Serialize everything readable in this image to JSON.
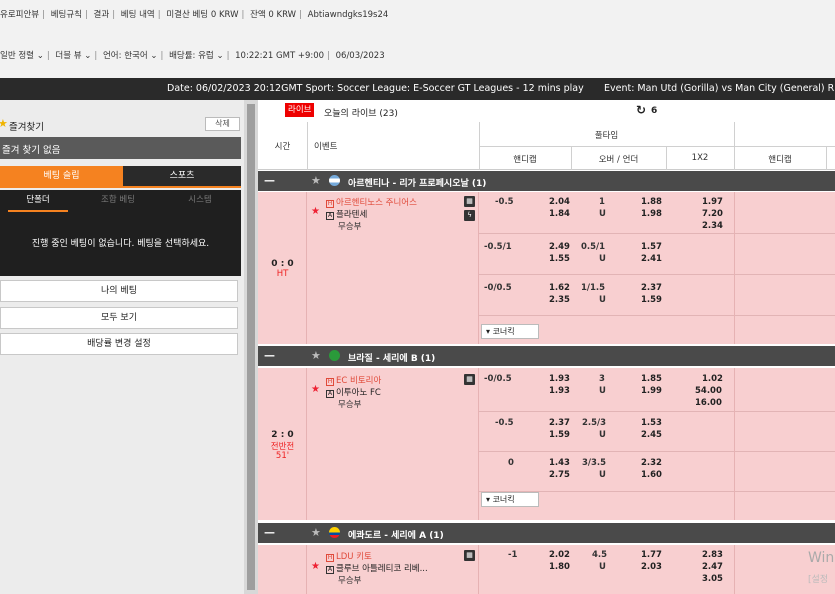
{
  "top_links": [
    "유로피안뷰",
    "베팅규칙",
    "결과",
    "베팅 내역",
    "미결산 베팅 0 KRW",
    "잔액 0 KRW",
    "Abtiawndgks19s24"
  ],
  "top_options": {
    "sort": "일반 정렬",
    "view": "더블 뷰",
    "language_label": "언어:",
    "language": "한국어",
    "odds_label": "배당률:",
    "odds": "유럽",
    "time": "10:22:21 GMT +9:00",
    "date": "06/03/2023"
  },
  "ticker": {
    "segment1": "Date: 06/02/2023 20:12GMT Sport: Soccer League: E-Soccer GT Leagues - 12 mins play",
    "segment2": "Event: Man Utd (Gorilla) vs Man City (General) R"
  },
  "sidebar": {
    "favorites_title": "즐겨찾기",
    "delete_label": "삭제",
    "no_favorites": "즐겨 찾기 없음",
    "tab_betslip": "베팅 슬립",
    "tab_sports": "스포츠",
    "subtab_single": "단폴더",
    "subtab_combo": "조합 베팅",
    "subtab_system": "시스템",
    "message": "진행 중인 베팅이 없습니다. 베팅을 선택하세요.",
    "btn_my_bets": "나의 베팅",
    "btn_view_all": "모두 보기",
    "btn_odds_settings": "배당률 변경 설정"
  },
  "live": {
    "badge": "라이브",
    "today": "오늘의 라이브 (23)",
    "refresh_icon": "refresh-icon",
    "refresh_count": "6"
  },
  "table_header": {
    "time": "시간",
    "event": "이벤트",
    "fulltime": "풀타임",
    "handicap": "핸디캡",
    "over_under": "오버 / 언더",
    "one_x_two": "1X2",
    "handicap2": "핸디캡"
  },
  "colors": {
    "accent": "#f58220",
    "live_red": "#e00000",
    "row_pink": "#f8cfd0",
    "league_bar": "#4a4a4a"
  },
  "leagues": [
    {
      "name": "아르헨티나 - 리가 프로페시오날 (1)",
      "flag": "argentina",
      "match": {
        "score": "0 : 0",
        "period": "HT",
        "minute": "",
        "home": "아르헨티노스 주니어스",
        "away": "플라텐세",
        "draw": "무승부",
        "rows": [
          {
            "hdp": "-0.5",
            "hdp_h": "2.04",
            "hdp_a": "1.84",
            "ou": "1",
            "ou_u": "",
            "ou_o": "1.88",
            "ou_un": "1.98",
            "x1": "1.97",
            "x2": "7.20",
            "xx": "2.34"
          },
          {
            "hdp": "-0.5/1",
            "hdp_h": "2.49",
            "hdp_a": "1.55",
            "ou": "0.5/1",
            "ou_u": "U",
            "ou_o": "1.57",
            "ou_un": "2.41",
            "x1": "",
            "x2": "",
            "xx": ""
          },
          {
            "hdp": "-0/0.5",
            "hdp_h": "1.62",
            "hdp_a": "2.35",
            "ou": "1/1.5",
            "ou_u": "U",
            "ou_o": "2.37",
            "ou_un": "1.59",
            "x1": "",
            "x2": "",
            "xx": ""
          }
        ],
        "corner": "코너킥"
      }
    },
    {
      "name": "브라질 - 세리에 B (1)",
      "flag": "brazil",
      "match": {
        "score": "2 : 0",
        "period": "전반전",
        "minute": "51'",
        "home": "EC 비토리아",
        "away": "이투아노 FC",
        "draw": "무승부",
        "rows": [
          {
            "hdp": "-0/0.5",
            "hdp_h": "1.93",
            "hdp_a": "1.93",
            "ou": "3",
            "ou_u": "U",
            "ou_o": "1.85",
            "ou_un": "1.99",
            "x1": "1.02",
            "x2": "54.00",
            "xx": "16.00"
          },
          {
            "hdp": "-0.5",
            "hdp_h": "2.37",
            "hdp_a": "1.59",
            "ou": "2.5/3",
            "ou_u": "U",
            "ou_o": "1.53",
            "ou_un": "2.45",
            "x1": "",
            "x2": "",
            "xx": ""
          },
          {
            "hdp": "0",
            "hdp_h": "1.43",
            "hdp_a": "2.75",
            "ou": "3/3.5",
            "ou_u": "U",
            "ou_o": "2.32",
            "ou_un": "1.60",
            "x1": "",
            "x2": "",
            "xx": ""
          }
        ],
        "corner": "코너킥"
      }
    },
    {
      "name": "에콰도르 - 세리에 A (1)",
      "flag": "ecuador",
      "match": {
        "score": "",
        "period": "",
        "minute": "",
        "home": "LDU 키토",
        "away": "클루브 아틀레티코 리베...",
        "draw": "무승부",
        "rows": [
          {
            "hdp": "-1",
            "hdp_h": "2.02",
            "hdp_a": "1.80",
            "ou": "4.5",
            "ou_u": "U",
            "ou_o": "1.77",
            "ou_un": "2.03",
            "x1": "2.83",
            "x2": "2.47",
            "xx": "3.05"
          }
        ],
        "corner": ""
      }
    }
  ],
  "watermark": {
    "line1": "Win",
    "line2": "[설정"
  }
}
